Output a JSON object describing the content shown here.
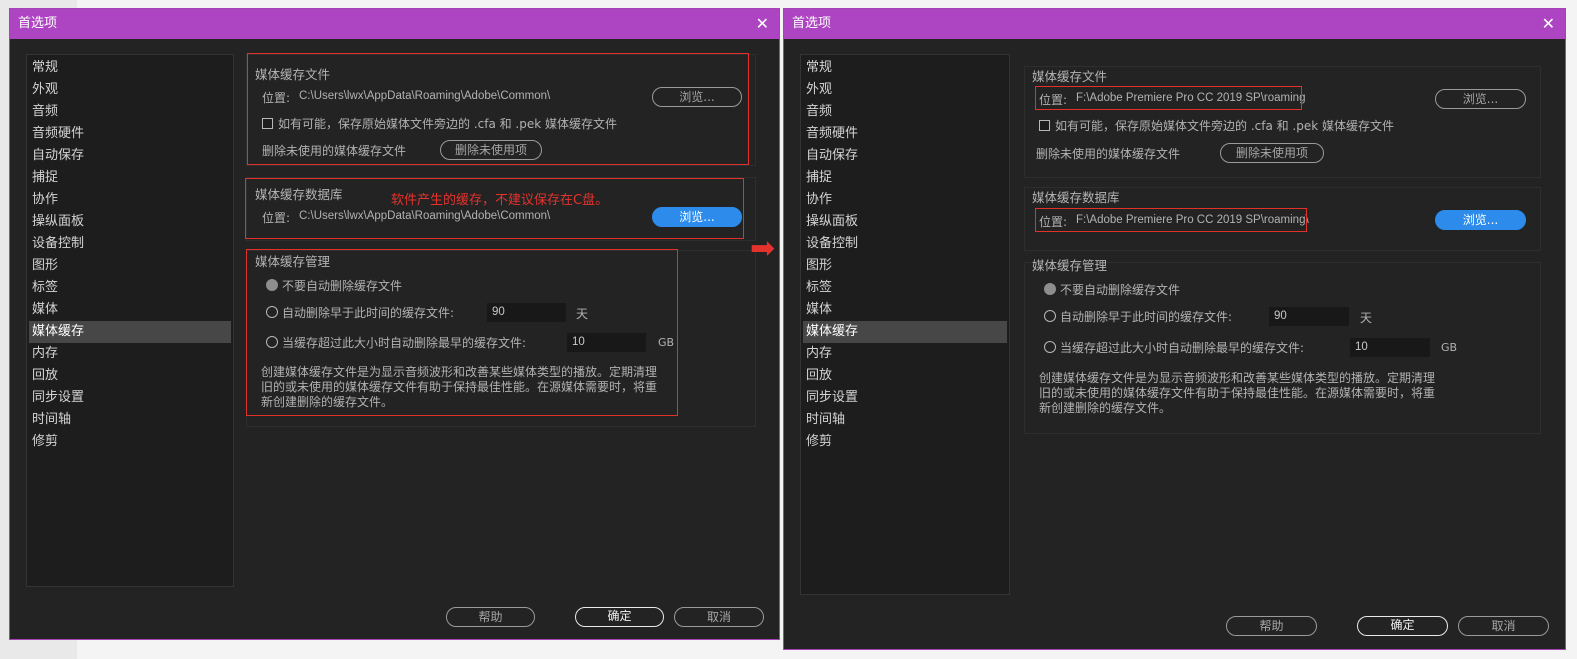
{
  "dialog_title": "首选项",
  "close_glyph": "✕",
  "sidebar": [
    "常规",
    "外观",
    "音频",
    "音频硬件",
    "自动保存",
    "捕捉",
    "协作",
    "操纵面板",
    "设备控制",
    "图形",
    "标签",
    "媒体",
    "媒体缓存",
    "内存",
    "回放",
    "同步设置",
    "时间轴",
    "修剪"
  ],
  "selected_item": "媒体缓存",
  "labels": {
    "cache_files": "媒体缓存文件",
    "location_prefix": "位置:",
    "browse": "浏览...",
    "save_beside_original": "如有可能，保存原始媒体文件旁边的 .cfa 和 .pek 媒体缓存文件",
    "delete_unused_label": "删除未使用的媒体缓存文件",
    "delete_unused_button": "删除未使用项",
    "database": "媒体缓存数据库",
    "management": "媒体缓存管理",
    "option_never": "不要自动删除缓存文件",
    "option_older": "自动删除早于此时间的缓存文件:",
    "days_unit": "天",
    "option_larger": "当缓存超过此大小时自动删除最早的缓存文件:",
    "gb_unit": "GB",
    "description": "创建媒体缓存文件是为显示音频波形和改善某些媒体类型的播放。定期清理旧的或未使用的媒体缓存文件有助于保持最佳性能。在源媒体需要时，将重新创建删除的缓存文件。",
    "help": "帮助",
    "ok": "确定",
    "cancel": "取消"
  },
  "values": {
    "days": "90",
    "gb": "10"
  },
  "left_dialog": {
    "cache_files_location": "C:\\Users\\lwx\\AppData\\Roaming\\Adobe\\Common\\",
    "database_location": "C:\\Users\\lwx\\AppData\\Roaming\\Adobe\\Common\\",
    "annotation": "软件产生的缓存，不建议保存在C盘。"
  },
  "right_dialog": {
    "cache_files_location": "F:\\Adobe Premiere Pro CC 2019 SP\\roaming",
    "database_location": "F:\\Adobe Premiere Pro CC 2019 SP\\roaming\\"
  },
  "arrow_glyph": "➡",
  "colors": {
    "titlebar": "#ad45c2",
    "accent_button": "#2d8ceb",
    "annotation_red": "#e4332d"
  }
}
